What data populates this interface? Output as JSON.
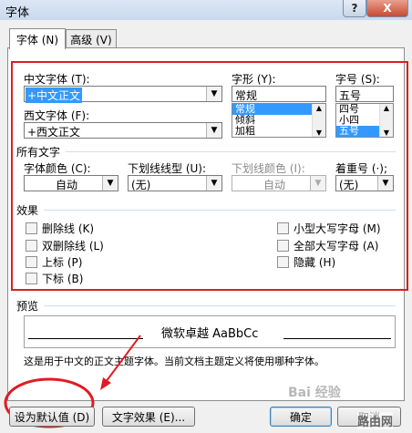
{
  "window": {
    "title": "字体",
    "help_glyph": "?",
    "close_glyph": "X"
  },
  "tabs": [
    {
      "label": "字体 (N)"
    },
    {
      "label": "高级 (V)"
    }
  ],
  "font": {
    "chinese_label": "中文字体 (T):",
    "chinese_value": "+中文正文",
    "western_label": "西文字体 (F):",
    "western_value": "+西文正文",
    "style_label": "字形 (Y):",
    "style_value": "常规",
    "style_options": [
      "常规",
      "倾斜",
      "加粗"
    ],
    "size_label": "字号 (S):",
    "size_value": "五号",
    "size_options": [
      "四号",
      "小四",
      "五号"
    ]
  },
  "all_text": {
    "heading": "所有文字",
    "font_color_label": "字体颜色 (C):",
    "font_color_value": "自动",
    "underline_style_label": "下划线线型 (U):",
    "underline_style_value": "(无)",
    "underline_color_label": "下划线颜色 (I):",
    "underline_color_value": "自动",
    "emphasis_label": "着重号 (·);",
    "emphasis_value": "(无)"
  },
  "effects": {
    "heading": "效果",
    "left": [
      {
        "label": "删除线 (K)",
        "checked": false
      },
      {
        "label": "双删除线 (L)",
        "checked": false
      },
      {
        "label": "上标 (P)",
        "checked": false
      },
      {
        "label": "下标 (B)",
        "checked": false
      }
    ],
    "right": [
      {
        "label": "小型大写字母 (M)",
        "checked": false
      },
      {
        "label": "全部大写字母 (A)",
        "checked": false
      },
      {
        "label": "隐藏 (H)",
        "checked": false
      }
    ]
  },
  "preview": {
    "heading": "预览",
    "sample": "微软卓越  AaBbCc",
    "note": "这是用于中文的正文主题字体。当前文档主题定义将使用哪种字体。"
  },
  "buttons": {
    "set_default": "设为默认值 (D)",
    "text_effects": "文字效果 (E)...",
    "ok": "确定",
    "cancel": "取消"
  },
  "watermark": {
    "baidu": "Bai 经验",
    "site": "路由网"
  },
  "colors": {
    "annotation_red": "#e01b24",
    "selection_blue": "#3399ff"
  }
}
